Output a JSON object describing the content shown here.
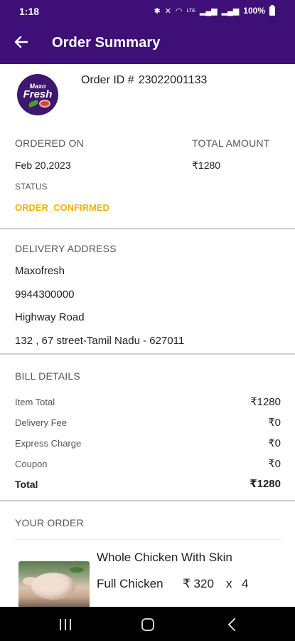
{
  "status_bar": {
    "time": "1:18",
    "battery": "100%",
    "icons": [
      "bluetooth-icon",
      "mute-icon",
      "wifi-icon",
      "volte-icon",
      "signal-icon",
      "signal-icon",
      "battery-icon"
    ]
  },
  "app_bar": {
    "title": "Order Summary",
    "back_icon": "arrow-left-icon"
  },
  "brand_logo": {
    "line1": "Maxo",
    "line2": "Fresh"
  },
  "order": {
    "id_label": "Order ID #",
    "id_value": "23022001133",
    "ordered_on_label": "ORDERED ON",
    "ordered_on_value": "Feb 20,2023",
    "total_amount_label": "TOTAL AMOUNT",
    "total_amount_value": "₹1280",
    "status_label": "STATUS",
    "status_value": "ORDER_CONFIRMED"
  },
  "delivery": {
    "heading": "DELIVERY ADDRESS",
    "name": "Maxofresh",
    "phone": "9944300000",
    "line1": "Highway Road",
    "line2": "132 , 67 street-Tamil Nadu -  627011"
  },
  "bill": {
    "heading": "BILL DETAILS",
    "rows": [
      {
        "label": "Item Total",
        "value": "₹1280"
      },
      {
        "label": "Delivery Fee",
        "value": "₹0"
      },
      {
        "label": "Express Charge",
        "value": "₹0"
      },
      {
        "label": "Coupon",
        "value": "₹0"
      }
    ],
    "total_label": "Total",
    "total_value": "₹1280"
  },
  "your_order": {
    "heading": "YOUR ORDER",
    "items": [
      {
        "name": "Whole Chicken With Skin",
        "variant": "Full Chicken",
        "price": "₹ 320",
        "times": "x",
        "qty": "4"
      }
    ]
  },
  "nav_bar": {
    "icons": [
      "recent-apps-icon",
      "home-icon",
      "back-icon"
    ]
  },
  "colors": {
    "header_bg": "#3f0f78",
    "status_accent": "#f2b300"
  }
}
